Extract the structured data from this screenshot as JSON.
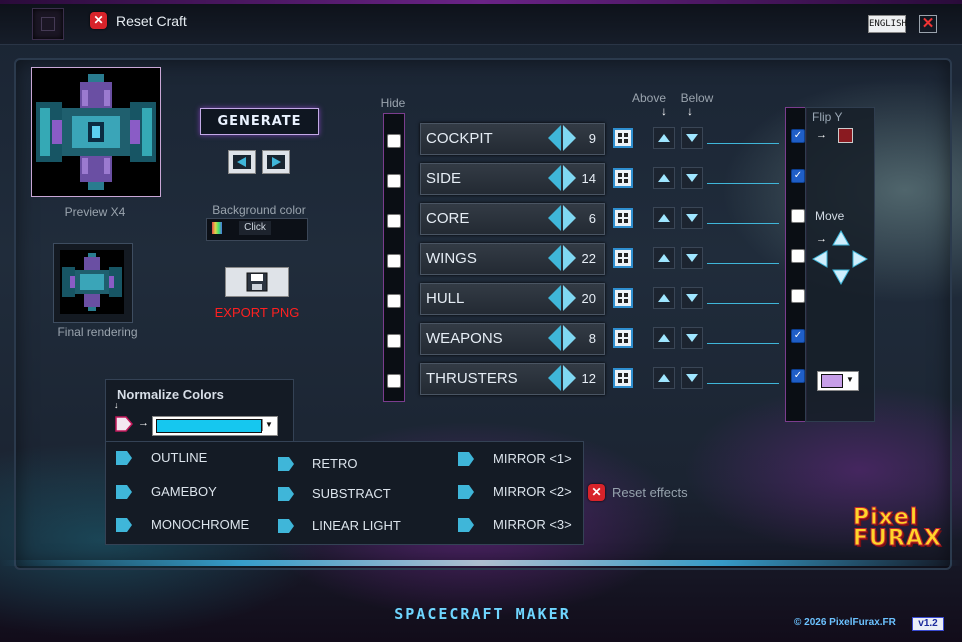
{
  "header": {
    "reset_craft": "Reset Craft",
    "language": "ENGLISH"
  },
  "preview": {
    "caption": "Preview X4",
    "final_caption": "Final rendering"
  },
  "controls": {
    "generate": "GENERATE",
    "bg_color_label": "Background color",
    "bg_click": "Click",
    "export": "EXPORT PNG"
  },
  "parts_header": {
    "hide": "Hide",
    "above": "Above",
    "below": "Below",
    "above_arrow": "↓",
    "below_arrow": "↓"
  },
  "parts": [
    {
      "name": "COCKPIT",
      "value": "9",
      "hidden": false,
      "flip": true
    },
    {
      "name": "SIDE",
      "value": "14",
      "hidden": false,
      "flip": true
    },
    {
      "name": "CORE",
      "value": "6",
      "hidden": false,
      "flip": false
    },
    {
      "name": "WINGS",
      "value": "22",
      "hidden": false,
      "flip": false
    },
    {
      "name": "HULL",
      "value": "20",
      "hidden": false,
      "flip": false
    },
    {
      "name": "WEAPONS",
      "value": "8",
      "hidden": false,
      "flip": true
    },
    {
      "name": "THRUSTERS",
      "value": "12",
      "hidden": false,
      "flip": true
    }
  ],
  "right": {
    "flip_y": "Flip Y",
    "move": "Move",
    "flip_arrow": "→",
    "move_arrow": "→"
  },
  "normalize": {
    "title": "Normalize Colors",
    "color": "#16c7ef",
    "arrow": "→",
    "down_arrow": "↓"
  },
  "effects": {
    "col1": [
      "OUTLINE",
      "GAMEBOY",
      "MONOCHROME"
    ],
    "col2": [
      "RETRO",
      "SUBSTRACT",
      "LINEAR LIGHT"
    ],
    "col3": [
      "MIRROR <1>",
      "MIRROR <2>",
      "MIRROR <3>"
    ],
    "reset": "Reset effects"
  },
  "footer": {
    "title": "SPACECRAFT MAKER",
    "copyright": "© 2026 PixelFurax.FR",
    "version": "v1.2",
    "logo_line1": "Pixel",
    "logo_line2": "FURAX"
  },
  "colors": {
    "accent": "#3fb6d9",
    "frame_purple": "#7b3d8e",
    "danger": "#d8232a",
    "flip_color": "#8a1a20",
    "hue_color": "#c79ee8"
  }
}
